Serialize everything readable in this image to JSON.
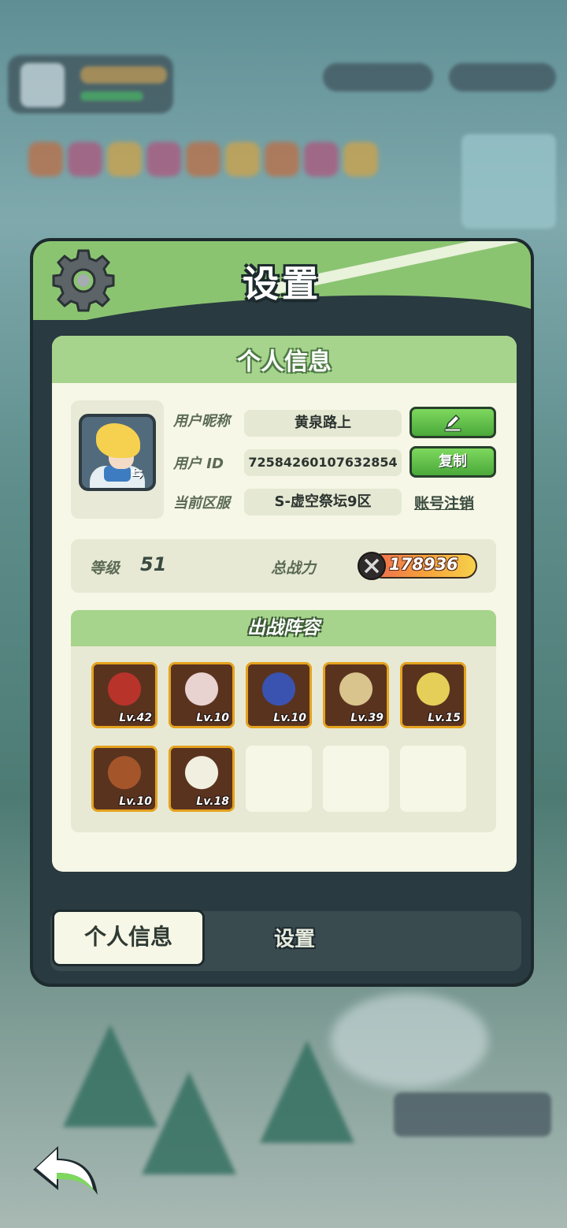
{
  "panel": {
    "title": "设置",
    "section_title": "个人信息"
  },
  "profile": {
    "nickname_label": "用户昵称",
    "nickname": "黄泉路上",
    "id_label": "用户 ID",
    "user_id": "725842601076328​54",
    "server_label": "当前区服",
    "server": "S-虚空祭坛9区",
    "copy_label": "复制",
    "logout_label": "账号注销",
    "edit_icon": "pencil-icon",
    "swap_icon": "swap-arrows-icon"
  },
  "stats": {
    "level_label": "等级",
    "level": "51",
    "power_label": "总战力",
    "power": "178936"
  },
  "lineup": {
    "title": "出战阵容",
    "heroes": [
      {
        "level": "Lv.42",
        "color": "#b8332a"
      },
      {
        "level": "Lv.10",
        "color": "#e9d3d0"
      },
      {
        "level": "Lv.10",
        "color": "#3a53b0"
      },
      {
        "level": "Lv.39",
        "color": "#d8c48c"
      },
      {
        "level": "Lv.15",
        "color": "#e6cf58"
      },
      {
        "level": "Lv.10",
        "color": "#a5552a"
      },
      {
        "level": "Lv.18",
        "color": "#f1efe0"
      }
    ],
    "empty_slots": 3
  },
  "tabs": {
    "active": "个人信息",
    "inactive": "设置"
  },
  "colors": {
    "accent_green": "#8bc471",
    "panel_dark": "#293a40",
    "card_bg": "#f6f7e6",
    "hero_border": "#e5a21e"
  }
}
